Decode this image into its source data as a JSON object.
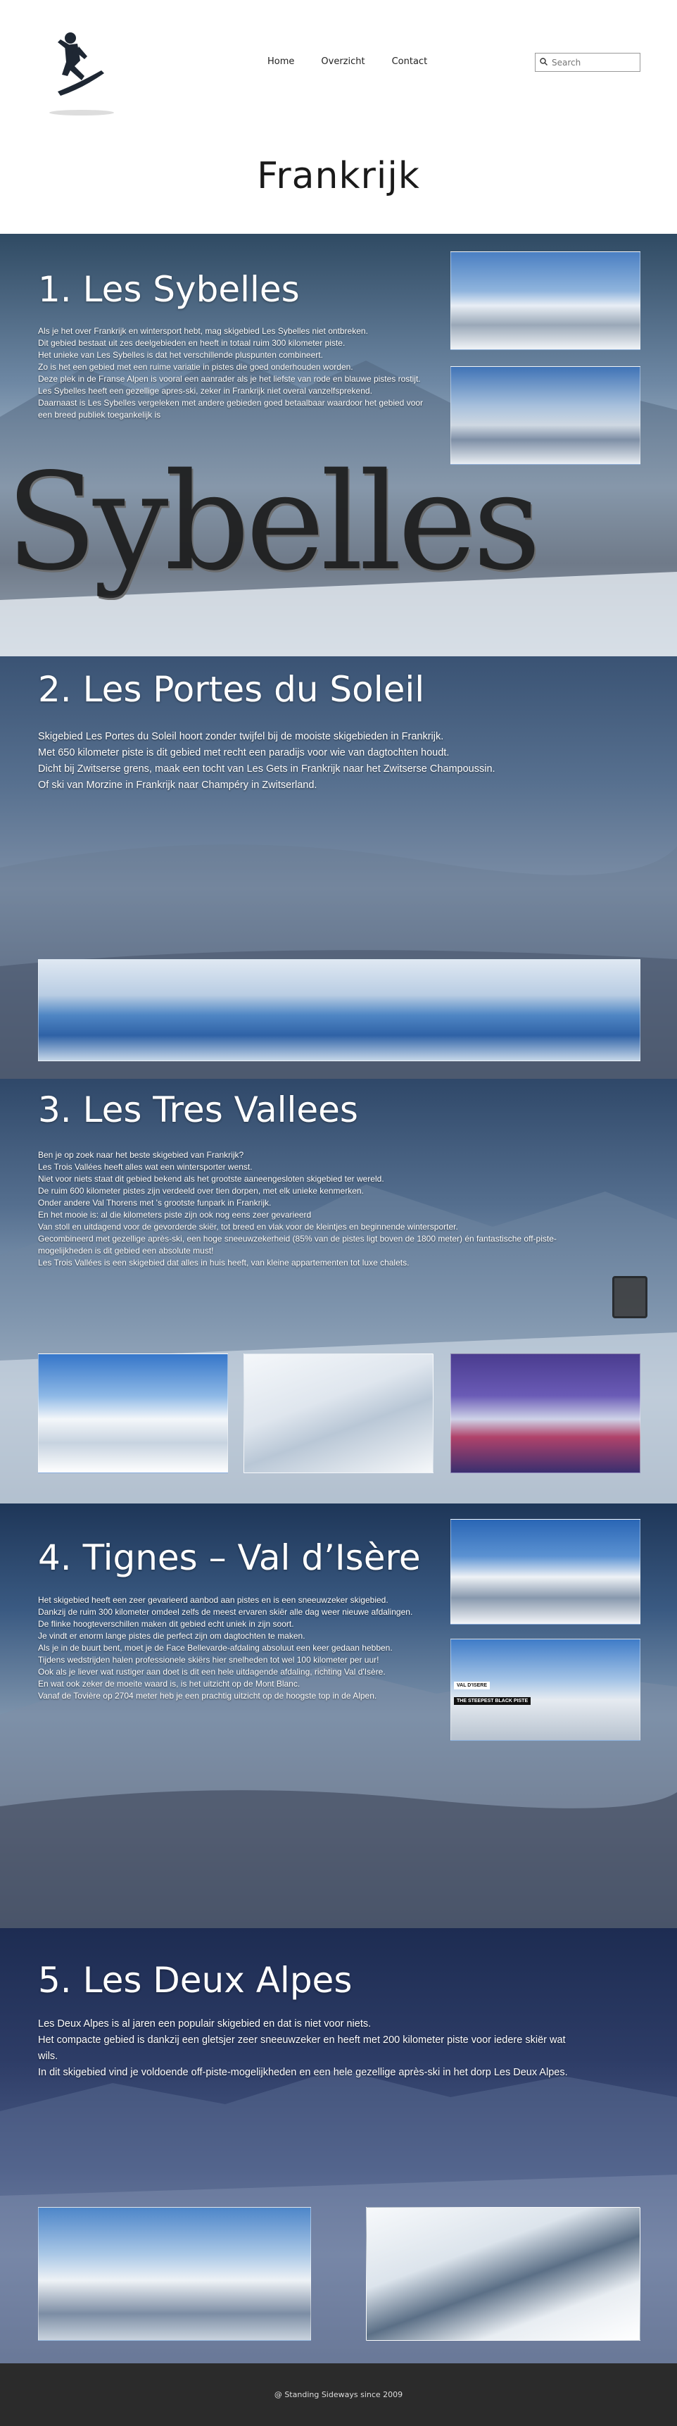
{
  "nav": {
    "home": "Home",
    "overview": "Overzicht",
    "contact": "Contact",
    "search_placeholder": "Search"
  },
  "page_title": "Frankrijk",
  "sections": [
    {
      "title": "1. Les Sybelles",
      "paragraphs": [
        "Als je het over Frankrijk en wintersport hebt, mag skigebied Les Sybelles niet ontbreken.",
        "Dit gebied bestaat uit zes deelgebieden en heeft in totaal ruim 300 kilometer piste.",
        "Het unieke van Les Sybelles is dat het verschillende pluspunten combineert.",
        "Zo is het een gebied met een ruime variatie in pistes die goed onderhouden worden.",
        "Deze plek in de Franse Alpen is vooral een aanrader als je het liefste van rode en blauwe pistes rostijt.",
        "Les Sybelles heeft een gezellige apres-ski, zeker in Frankrijk niet overal vanzelfsprekend.",
        "Daarnaast is Les Sybelles vergeleken met andere gebieden goed betaalbaar waardoor het gebied voor een breed publiek toegankelijk is"
      ],
      "sign_text": "Sybelles"
    },
    {
      "title": "2. Les Portes du Soleil",
      "paragraphs": [
        "Skigebied Les Portes du Soleil hoort zonder twijfel bij de mooiste skigebieden in Frankrijk.",
        "Met 650 kilometer piste is dit gebied met recht een paradijs voor wie van dagtochten houdt.",
        "Dicht bij Zwitserse grens, maak een tocht van Les Gets in Frankrijk naar het Zwitserse Champoussin.",
        "Of ski van Morzine in Frankrijk naar Champéry in Zwitserland."
      ]
    },
    {
      "title": "3. Les Tres Vallees",
      "paragraphs": [
        "Ben je op zoek naar het beste skigebied van Frankrijk?",
        "Les Trois Vallées heeft alles wat een wintersporter wenst.",
        "Niet voor niets staat dit gebied bekend als het grootste aaneengesloten skigebied ter wereld.",
        "De ruim 600 kilometer pistes zijn verdeeld over tien dorpen, met elk unieke kenmerken.",
        "Onder andere Val Thorens met 's grootste funpark in Frankrijk.",
        "En het mooie is: al die kilometers piste zijn ook nog eens zeer gevarieerd",
        "Van stoll en uitdagend voor de gevorderde skiër, tot breed en vlak voor de kleintjes en beginnende wintersporter.",
        "Gecombineerd met gezellige après-ski, een hoge sneeuwzekerheid (85% van de pistes ligt boven de 1800 meter) én fantastische off-piste-mogelijkheden is dit gebied een absolute must!",
        "Les Trois Vallées is een skigebied dat alles in huis heeft, van kleine appartementen tot luxe chalets."
      ]
    },
    {
      "title": "4. Tignes – Val d’Isère",
      "paragraphs": [
        "Het skigebied heeft een zeer gevarieerd aanbod aan pistes en is een sneeuwzeker skigebied.",
        "Dankzij de ruim 300 kilometer omdeel zelfs de meest ervaren skiër alle dag weer nieuwe afdalingen.",
        "De flinke hoogteverschillen maken dit gebied echt uniek in zijn soort.",
        "Je vindt er enorm lange pistes die perfect zijn om dagtochten te maken.",
        "Als je in de buurt bent, moet je de Face Bellevarde-afdaling absoluut een keer gedaan hebben.",
        "Tijdens wedstrijden halen professionele skiërs hier snelheden tot wel 100 kilometer per uur!",
        "Ook als je liever wat rustiger aan doet is dit een hele uitdagende afdaling, richting Val d'Isère.",
        "En wat ook zeker de moeite waard is, is het uitzicht op de Mont Blanc.",
        "Vanaf de Tovière op 2704 meter heb je een prachtig uitzicht op de hoogste top in de Alpen."
      ],
      "photo_caption_1": "VAL D'ISERE",
      "photo_caption_2": "THE STEEPEST BLACK PISTE"
    },
    {
      "title": "5. Les Deux Alpes",
      "paragraphs": [
        "Les Deux Alpes is al jaren een populair skigebied en dat is niet voor niets.",
        "Het compacte gebied is dankzij een gletsjer zeer sneeuwzeker en heeft met 200 kilometer piste voor iedere skiër wat wils.",
        "In dit skigebied vind je voldoende off-piste-mogelijkheden en een hele gezellige après-ski in het dorp Les Deux Alpes."
      ]
    }
  ],
  "footer": "@ Standing Sideways since 2009"
}
